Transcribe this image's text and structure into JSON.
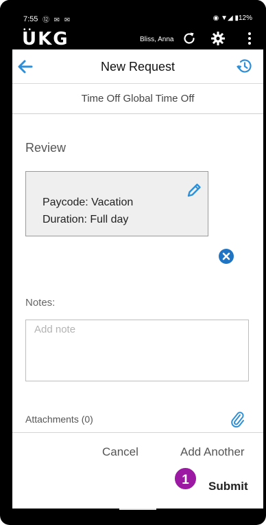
{
  "status_bar": {
    "time": "7:55",
    "notification_icons": "⑫ ✉ ✉",
    "system_icons": "◉ ▼◢ ▮12%"
  },
  "app_bar": {
    "logo": "UKG",
    "user_name": "Bliss, Anna",
    "icons": [
      "refresh-icon",
      "gear-icon",
      "more-vert-icon"
    ]
  },
  "nav": {
    "title": "New Request",
    "back_icon": "arrow-left-icon",
    "history_icon": "history-icon"
  },
  "request_type": "Time Off Global Time Off",
  "review": {
    "label": "Review",
    "paycode_line": "Paycode: Vacation",
    "duration_line": "Duration: Full day"
  },
  "notes": {
    "label": "Notes:",
    "placeholder": "Add note",
    "value": ""
  },
  "attachments": {
    "label": "Attachments (0)"
  },
  "footer": {
    "cancel_label": "Cancel",
    "add_another_label": "Add Another",
    "submit_label": "Submit",
    "badge": "1"
  },
  "colors": {
    "accent_blue": "#2f8fd6",
    "badge_purple": "#9c1aa3",
    "remove_blue": "#1f74c4"
  }
}
